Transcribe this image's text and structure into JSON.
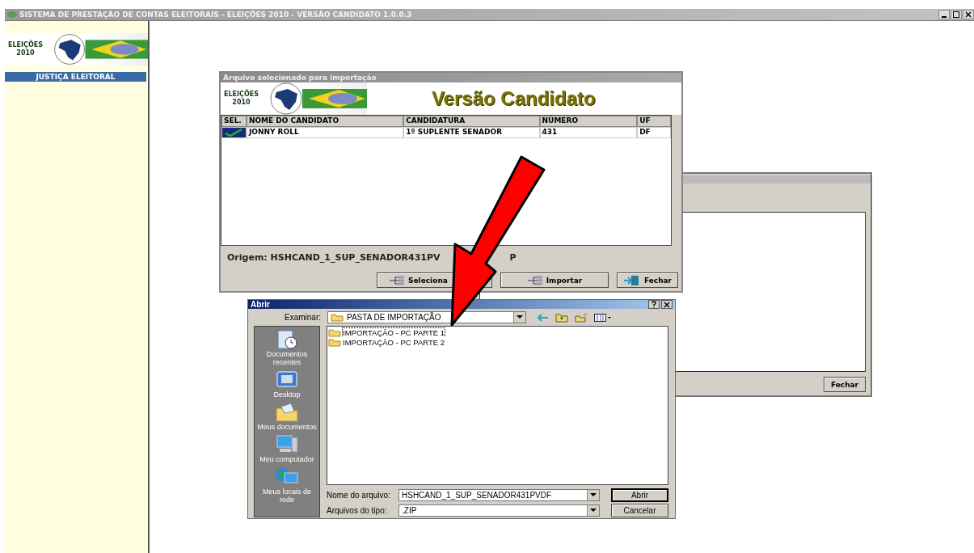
{
  "window": {
    "title": "SISTEMA DE PRESTAÇÃO DE CONTAS ELEITORAIS - ELEIÇÕES 2010 -  VERSÃO CANDIDATO 1.0.0.3"
  },
  "sidebar": {
    "logo_text": [
      "ELEIÇÕES",
      "2010"
    ],
    "banner": "JUSTIÇA ELEITORAL"
  },
  "back_window": {
    "button": "Fechar"
  },
  "import_dialog": {
    "title": "Arquivo selecionado para importação",
    "logo_text": [
      "ELEIÇÕES",
      "2010"
    ],
    "heading": "Versão Candidato",
    "columns": [
      "SEL.",
      "NOME DO CANDIDATO",
      "CANDIDATURA",
      "NÚMERO",
      "UF"
    ],
    "rows": [
      {
        "selected": true,
        "cells": [
          "",
          "JONNY ROLL",
          "1º SUPLENTE SENADOR",
          "431",
          "DF"
        ]
      }
    ],
    "origin": "Origem: HSHCAND_1_SUP_SENADOR431PV",
    "origin_tail": "P",
    "buttons": [
      {
        "label": "Seleciona"
      },
      {
        "label": "Importar"
      },
      {
        "label": "Fechar"
      }
    ]
  },
  "open_dialog": {
    "title": "Abrir",
    "look_in_label": "Examinar:",
    "look_in": "PASTA DE IMPORTAÇÃO",
    "places": [
      {
        "kind": "recent",
        "label": "Documentos recentes"
      },
      {
        "kind": "desktop",
        "label": "Desktop"
      },
      {
        "kind": "documents",
        "label": "Meus documentos"
      },
      {
        "kind": "computer",
        "label": "Meu computador"
      },
      {
        "kind": "network",
        "label": "Meus locais de rede"
      }
    ],
    "files": [
      {
        "name": "IMPORTAÇÃO - PC PARTE 1",
        "selected": true
      },
      {
        "name": "IMPORTAÇÃO - PC PARTE 2",
        "selected": false
      }
    ],
    "filename_label": "Nome do arquivo:",
    "filename": "HSHCAND_1_SUP_SENADOR431PVDF",
    "filetype_label": "Arquivos do tipo:",
    "filetype": ".ZIP",
    "buttons": [
      "Abrir",
      "Cancelar"
    ]
  }
}
